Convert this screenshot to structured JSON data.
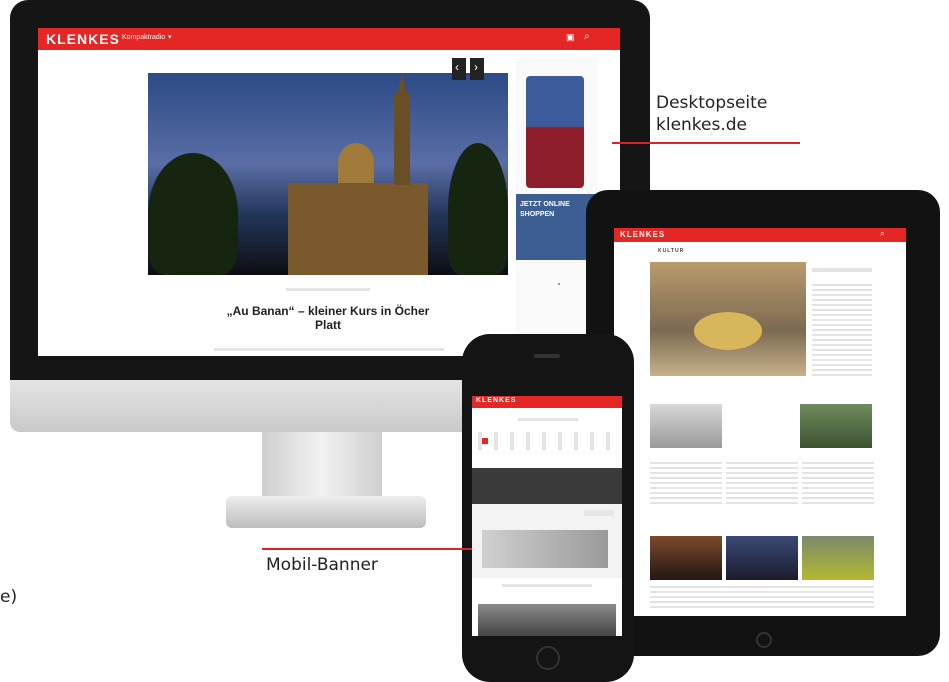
{
  "callouts": {
    "desktop_line1": "Desktopseite",
    "desktop_line2": "klenkes.de",
    "mobile": "Mobil-Banner"
  },
  "desktop": {
    "logo": "KLENKES",
    "nav_dropdown": "Kompaktradio",
    "headline_line1": "„Au Banan“ – kleiner Kurs in Öcher",
    "headline_line2": "Platt",
    "ad_text": "JETZT ONLINE SHOPPEN"
  },
  "tablet": {
    "logo": "KLENKES",
    "section_title": "KULTUR"
  },
  "phone": {
    "logo": "KLENKES"
  },
  "colors": {
    "brand_red": "#e42625",
    "callout_line": "#d9252a"
  }
}
